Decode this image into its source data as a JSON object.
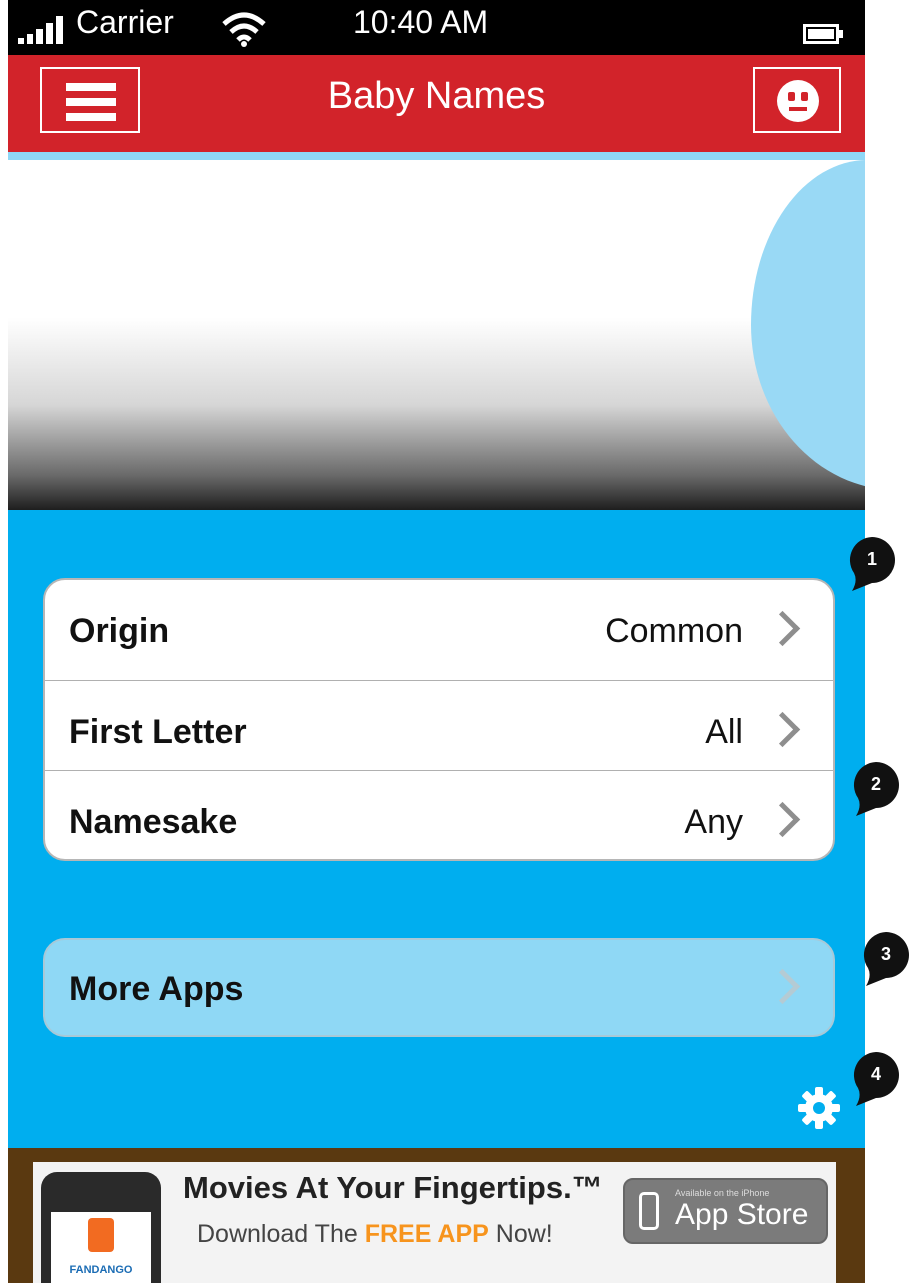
{
  "status_bar": {
    "carrier": "Carrier",
    "time": "10:40 AM"
  },
  "nav": {
    "title": "Baby Names",
    "left_icon": "hamburger-menu-icon",
    "right_icon": "smiley-face-icon"
  },
  "colors": {
    "nav_bar": "#d2232a",
    "background": "#00aeef",
    "more_apps": "#8fd8f5",
    "hero_accent": "#99d9f5"
  },
  "filters": [
    {
      "label": "Origin",
      "value": "Common"
    },
    {
      "label": "First Letter",
      "value": "All"
    },
    {
      "label": "Namesake",
      "value": "Any"
    }
  ],
  "more_apps": {
    "label": "More Apps"
  },
  "settings_icon": "gear-icon",
  "ad": {
    "headline": "Movies At Your Fingertips.™",
    "sub_prefix": "Download The ",
    "sub_highlight": "FREE APP",
    "sub_suffix": " Now!",
    "brand": "FANDANGO",
    "store_small": "Available on the iPhone",
    "store_big": "App Store"
  },
  "callouts": [
    "1",
    "2",
    "3",
    "4"
  ]
}
